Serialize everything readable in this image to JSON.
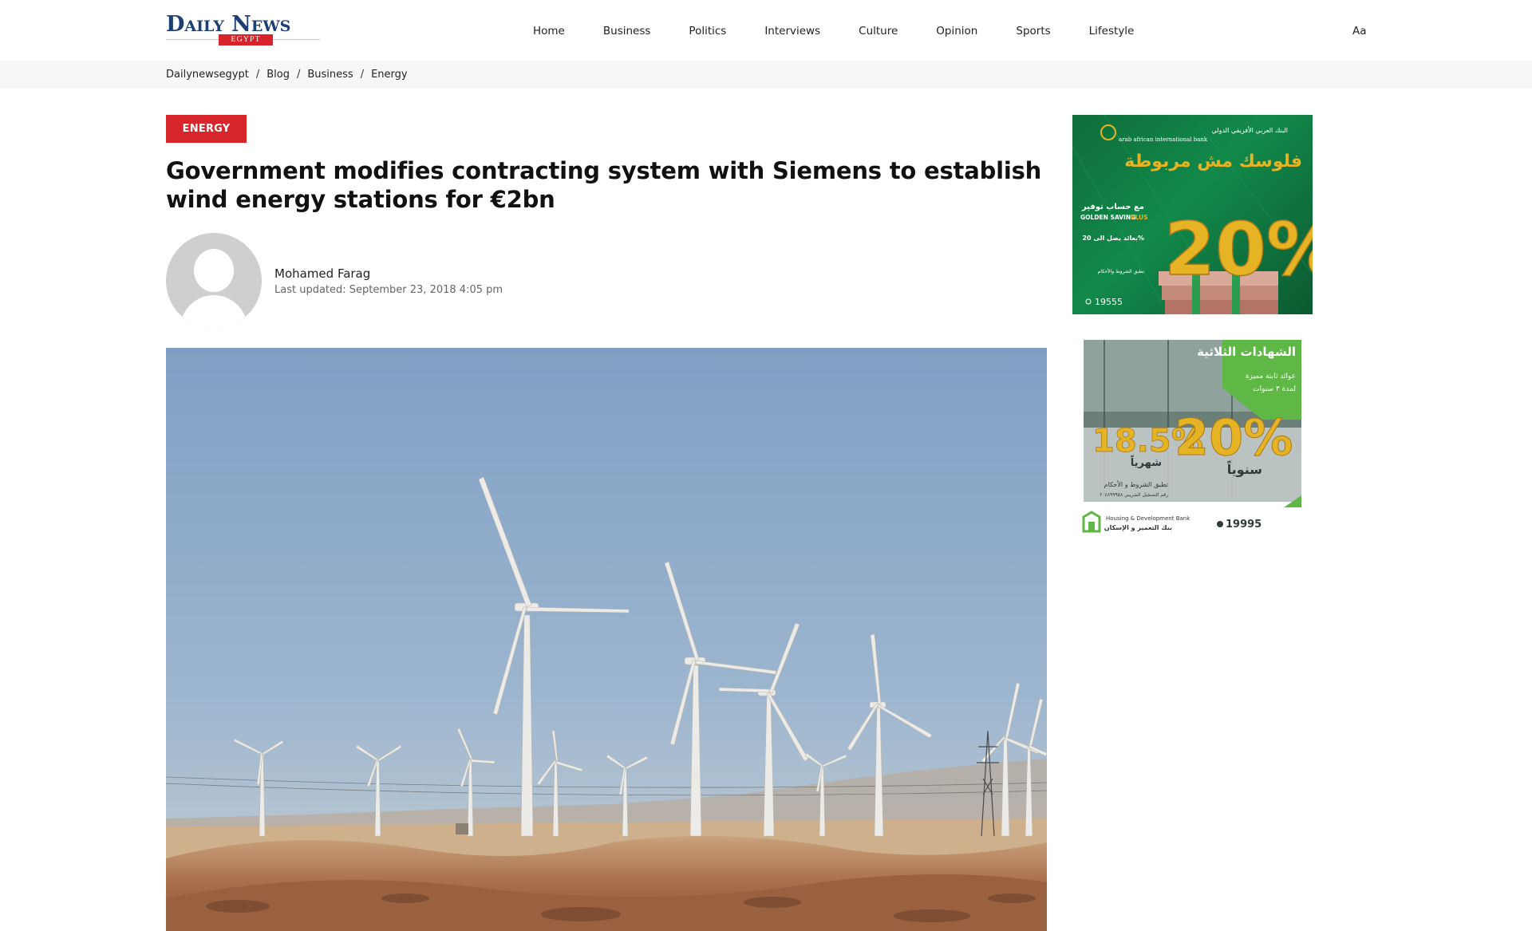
{
  "header": {
    "logo": {
      "main": "Daily News",
      "sub": "EGYPT"
    },
    "nav": [
      {
        "label": "Home"
      },
      {
        "label": "Business"
      },
      {
        "label": "Politics"
      },
      {
        "label": "Interviews"
      },
      {
        "label": "Culture"
      },
      {
        "label": "Opinion"
      },
      {
        "label": "Sports"
      },
      {
        "label": "Lifestyle"
      }
    ],
    "font_size_label": "Aa"
  },
  "breadcrumb": {
    "items": [
      "Dailynewsegypt",
      "Blog",
      "Business",
      "Energy"
    ],
    "separator": "/"
  },
  "article": {
    "category": "ENERGY",
    "title": "Government modifies contracting system with Siemens to establish wind energy stations for €2bn",
    "author": "Mohamed Farag",
    "last_updated": "Last updated: September 23, 2018 4:05 pm",
    "image_subject": "wind turbines in desert"
  },
  "sidebar": {
    "ad1": {
      "bank_name_ar": "البنك العربي الأفريقي الدولي",
      "bank_name_en": "arab african international bank",
      "headline_ar": "فلوسك مش مربوطة",
      "line_ar": "مع حساب توفير",
      "product_en": "GOLDEN SAVING",
      "product_plus": "PLUS",
      "rate_line_ar": "بعائد يصل الى 20%",
      "note_ar": "تطبق الشروط والأحكام",
      "hotline": "19555",
      "big_rate": "20%"
    },
    "ad2": {
      "title_ar": "الشهادات الثلاثية",
      "subtitle_ar": "عوائد ثابتة مميزة",
      "duration_ar": "لمدة ٣ سنوات",
      "rate_monthly": "18.5%",
      "monthly_ar": "شهرياً",
      "rate_annual": "20%",
      "annual_ar": "سنوياً",
      "terms_ar": "تطبق الشروط و الأحكام",
      "tax_ar": "رقم التسجيل الضريبي ٢٠٤٨٩٩٩٥٨",
      "bank_en": "Housing & Development Bank",
      "bank_ar": "بنك التعمير و الإسكان",
      "hotline": "19995"
    }
  },
  "colors": {
    "logo_blue": "#1d3f73",
    "accent_red": "#d7262b",
    "breadcrumb_bg": "#f6f7f9",
    "ad1_green": "#12894a",
    "ad2_green": "#5fb746",
    "gold": "#e6b325"
  }
}
